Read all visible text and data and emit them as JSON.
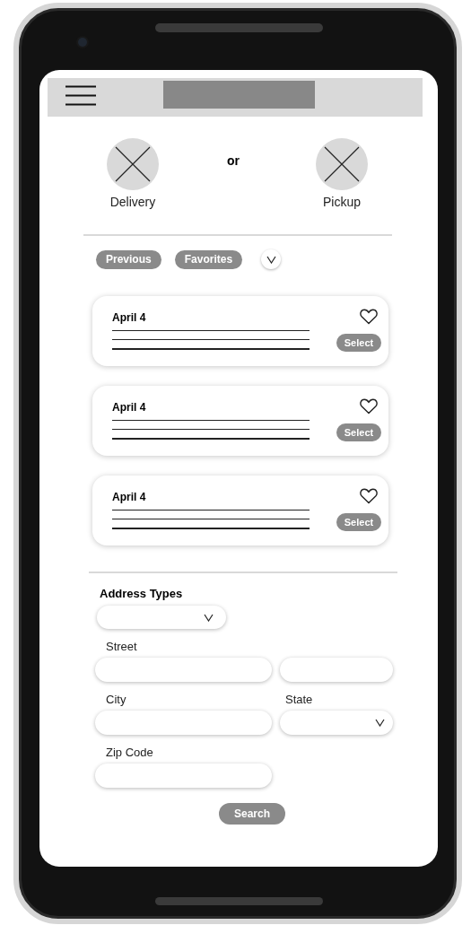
{
  "choices": [
    {
      "label": "Delivery"
    },
    {
      "label": "Pickup"
    }
  ],
  "separator": "or",
  "filters": [
    {
      "label": "Previous"
    },
    {
      "label": "Favorites"
    }
  ],
  "orders": [
    {
      "date": "April 4",
      "favorite": false,
      "button": "Select"
    },
    {
      "date": "April 4",
      "favorite": false,
      "button": "Select"
    },
    {
      "date": "April 4",
      "favorite": false,
      "button": "Select"
    }
  ],
  "address_form": {
    "title": "Address Types",
    "type_select": {
      "kind": "dropdown"
    },
    "rows": [
      [
        {
          "label": "Street",
          "kind": "text"
        },
        {
          "kind": "text"
        }
      ],
      [
        {
          "label": "City",
          "kind": "text"
        },
        {
          "label": "State",
          "kind": "dropdown"
        }
      ],
      [
        {
          "label": "Zip Code",
          "kind": "text"
        }
      ]
    ],
    "submit": "Search"
  }
}
